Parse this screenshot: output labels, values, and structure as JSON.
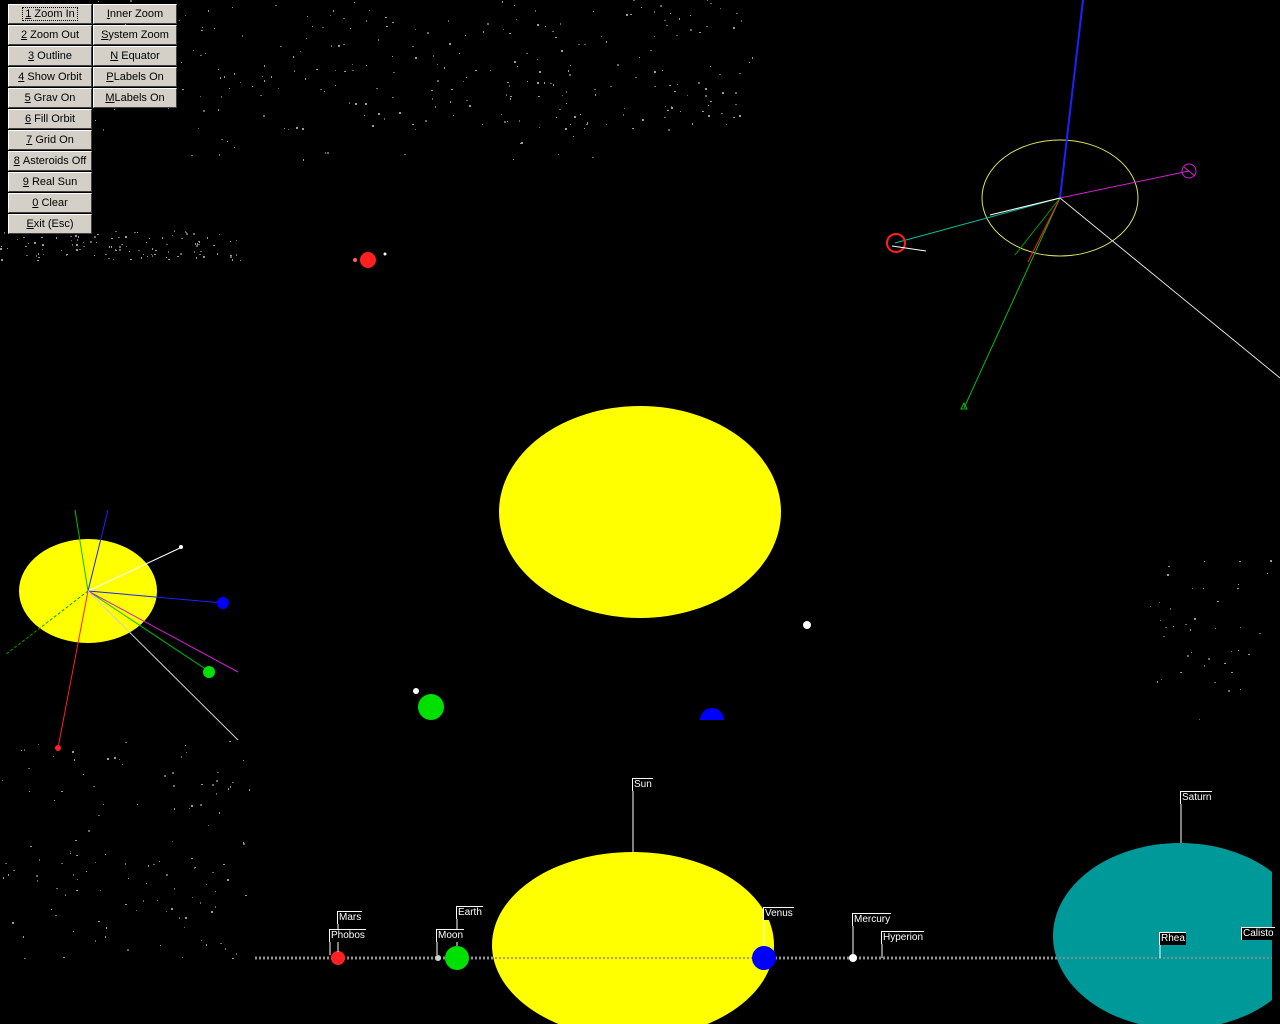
{
  "buttons_left": [
    {
      "key": "1",
      "rest": " Zoom In",
      "focused": true
    },
    {
      "key": "2",
      "rest": " Zoom Out"
    },
    {
      "key": "3",
      "rest": " Outline"
    },
    {
      "key": "4",
      "rest": " Show Orbit"
    },
    {
      "key": "5",
      "rest": " Grav On"
    },
    {
      "key": "6",
      "rest": " Fill Orbit"
    },
    {
      "key": "7",
      "rest": " Grid On"
    },
    {
      "key": "8",
      "rest": " Asteroids Off"
    },
    {
      "key": "9",
      "rest": " Real Sun"
    },
    {
      "key": "0",
      "rest": " Clear"
    },
    {
      "key": "E",
      "rest": "xit (Esc)"
    }
  ],
  "buttons_right": [
    {
      "key": "I",
      "rest": "nner Zoom"
    },
    {
      "key": "S",
      "rest": "ystem Zoom"
    },
    {
      "key": "N",
      "rest": " Equator"
    },
    {
      "key": "P",
      "rest": "Labels On"
    },
    {
      "key": "M",
      "rest": "Labels On"
    }
  ],
  "labels": {
    "sun": "Sun",
    "saturn": "Saturn",
    "mars": "Mars",
    "phobos": "Phobos",
    "earth": "Earth",
    "moon": "Moon",
    "venus": "Venus",
    "mercury": "Mercury",
    "hyperion": "Hyperion",
    "rhea": "Rhea",
    "calisto": "Calisto"
  },
  "colors": {
    "sun": "#ffff00",
    "saturn": "#009999",
    "mars": "#ff2020",
    "earth": "#00e000",
    "venus": "#0000ff",
    "button_face": "#d4d0c8"
  }
}
